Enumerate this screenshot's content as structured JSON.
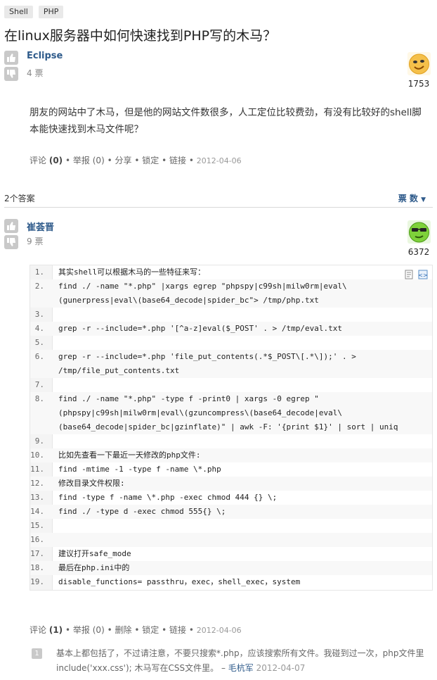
{
  "tags": [
    "Shell",
    "PHP"
  ],
  "question": {
    "title": "在linux服务器中如何快速找到PHP写的木马？",
    "author": "Eclipse",
    "votes": "4 票",
    "reputation": "1753",
    "body": "朋友的网站中了木马，但是他的网站文件数很多，人工定位比较费劲，有没有比较好的shell脚本能快速找到木马文件呢？",
    "actions": {
      "comment_label": "评论",
      "comment_count": "(0)",
      "report_label": "举报",
      "report_count": "(0)",
      "share": "分享",
      "lock": "锁定",
      "link": "链接",
      "date": "2012-04-06"
    }
  },
  "answers_header": {
    "count": "2个答案",
    "sort_label": "票 数"
  },
  "answer": {
    "author": "崔荟晋",
    "votes": "9 票",
    "reputation": "6372",
    "code_lines": [
      {
        "n": "1.",
        "t": "其实shell可以根据木马的一些特征来写："
      },
      {
        "n": "2.",
        "t": "find ./ -name \"*.php\" |xargs egrep \"phpspy|c99sh|milw0rm|eval\\"
      },
      {
        "n": "",
        "t": "(gunerpress|eval\\(base64_decode|spider_bc\"> /tmp/php.txt"
      },
      {
        "n": "3.",
        "t": ""
      },
      {
        "n": "4.",
        "t": "grep -r --include=*.php  '[^a-z]eval($_POST' . > /tmp/eval.txt"
      },
      {
        "n": "5.",
        "t": ""
      },
      {
        "n": "6.",
        "t": "grep -r --include=*.php  'file_put_contents(.*$_POST\\[.*\\]);' . >"
      },
      {
        "n": "",
        "t": "/tmp/file_put_contents.txt"
      },
      {
        "n": "7.",
        "t": ""
      },
      {
        "n": "8.",
        "t": "find ./ -name \"*.php\" -type f -print0 | xargs -0 egrep \""
      },
      {
        "n": "",
        "t": "(phpspy|c99sh|milw0rm|eval\\(gzuncompress\\(base64_decode|eval\\"
      },
      {
        "n": "",
        "t": "(base64_decode|spider_bc|gzinflate)\" | awk -F: '{print $1}' | sort | uniq"
      },
      {
        "n": "9.",
        "t": ""
      },
      {
        "n": "10.",
        "t": "比如先查看一下最近一天修改的php文件:"
      },
      {
        "n": "11.",
        "t": "find -mtime -1 -type f -name \\*.php"
      },
      {
        "n": "12.",
        "t": "修改目录文件权限:"
      },
      {
        "n": "13.",
        "t": "find -type f -name \\*.php -exec chmod 444 {} \\;"
      },
      {
        "n": "14.",
        "t": "find ./ -type d -exec chmod 555{} \\;"
      },
      {
        "n": "15.",
        "t": ""
      },
      {
        "n": "16.",
        "t": ""
      },
      {
        "n": "17.",
        "t": "建议打开safe_mode"
      },
      {
        "n": "18.",
        "t": "最后在php.ini中的"
      },
      {
        "n": "19.",
        "t": "disable_functions= passthru，exec，shell_exec，system"
      }
    ],
    "actions": {
      "comment_label": "评论",
      "comment_count": "(1)",
      "report_label": "举报",
      "report_count": "(0)",
      "delete": "删除",
      "lock": "锁定",
      "link": "链接",
      "date": "2012-04-06"
    },
    "comment": {
      "number": "1",
      "text": "基本上都包括了，不过请注意，不要只搜索*.php，应该搜索所有文件。我碰到过一次，php文件里include('xxx.css'); 木马写在CSS文件里。 –",
      "author": "毛杭军",
      "date": "2012-04-07"
    }
  }
}
